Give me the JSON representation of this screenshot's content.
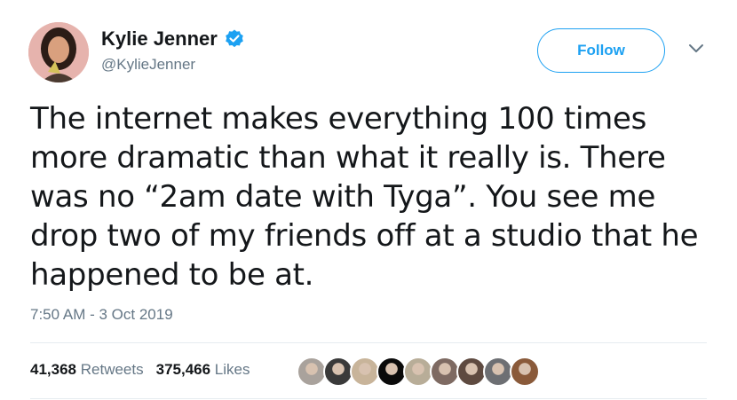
{
  "author": {
    "name": "Kylie Jenner",
    "handle": "@KylieJenner",
    "verified_icon": "verified-badge-icon"
  },
  "follow_label": "Follow",
  "tweet": {
    "lines": [
      "The internet makes everything 100 times",
      "more dramatic than what it really is. There",
      "was no “2am date with Tyga”. You see me",
      "drop two of my friends off at a studio that he",
      "happened to be at."
    ],
    "timestamp": "7:50 AM - 3 Oct 2019"
  },
  "stats": {
    "retweets_count": "41,368",
    "retweets_label": "Retweets",
    "likes_count": "375,466",
    "likes_label": "Likes"
  },
  "colors": {
    "accent": "#1da1f2",
    "text": "#14171a",
    "muted": "#657786",
    "divider": "#e6ecf0"
  },
  "likers": [
    {
      "color": "#a9a29c"
    },
    {
      "color": "#3a3a3a"
    },
    {
      "color": "#c8b49a"
    },
    {
      "color": "#0a0a0a"
    },
    {
      "color": "#b8ad98"
    },
    {
      "color": "#7e6a62"
    },
    {
      "color": "#5e4a40"
    },
    {
      "color": "#6d6f73"
    },
    {
      "color": "#8a5a3a"
    }
  ]
}
